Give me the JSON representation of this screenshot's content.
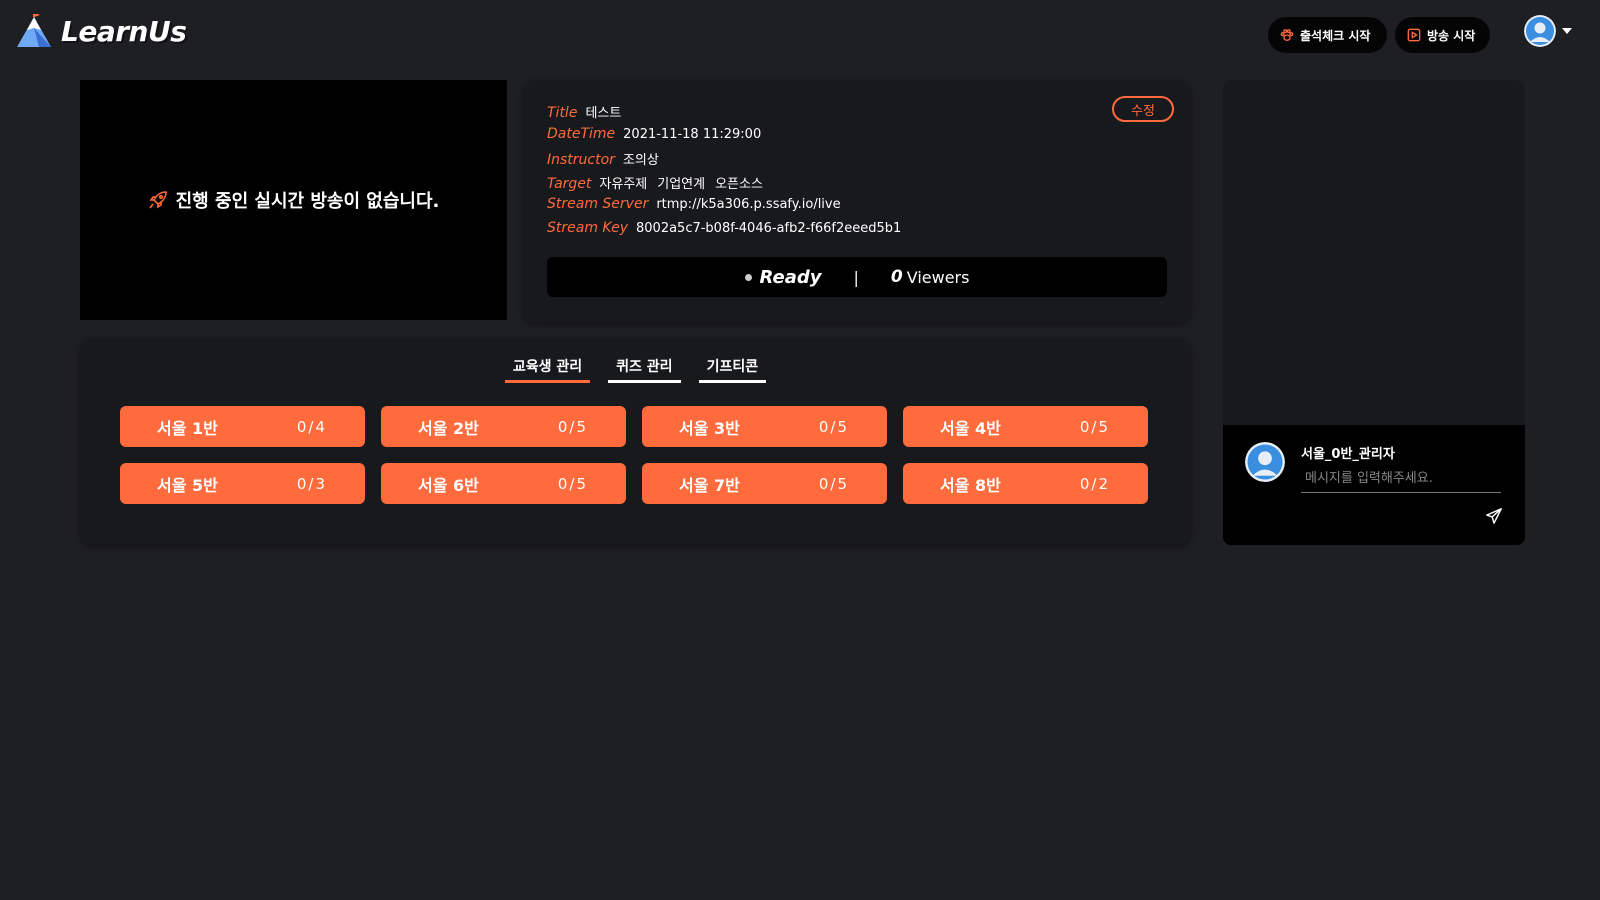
{
  "header": {
    "logo_text": "LearnUs",
    "attendance_button": "출석체크 시작",
    "broadcast_button": "방송 시작"
  },
  "video": {
    "no_stream_message": "진행 중인 실시간 방송이 없습니다."
  },
  "info": {
    "edit_button": "수정",
    "title_key": "Title",
    "title_value": "테스트",
    "datetime_key": "DateTime",
    "datetime_value": "2021-11-18 11:29:00",
    "instructor_key": "Instructor",
    "instructor_value": "조의상",
    "target_key": "Target",
    "targets": [
      "자유주제",
      "기업연계",
      "오픈소스"
    ],
    "server_key": "Stream Server",
    "server_value": "rtmp://k5a306.p.ssafy.io/live",
    "key_key": "Stream Key",
    "key_value": "8002a5c7-b08f-4046-afb2-f66f2eeed5b1"
  },
  "status": {
    "state": "Ready",
    "separator": "|",
    "viewer_count": "0",
    "viewers_label": "Viewers"
  },
  "tabs": [
    {
      "label": "교육생 관리",
      "active": true
    },
    {
      "label": "퀴즈 관리",
      "active": false
    },
    {
      "label": "기프티콘",
      "active": false
    }
  ],
  "classes": [
    {
      "name": "서울 1반",
      "count": "0/4"
    },
    {
      "name": "서울 2반",
      "count": "0/5"
    },
    {
      "name": "서울 3반",
      "count": "0/5"
    },
    {
      "name": "서울 4반",
      "count": "0/5"
    },
    {
      "name": "서울 5반",
      "count": "0/3"
    },
    {
      "name": "서울 6반",
      "count": "0/5"
    },
    {
      "name": "서울 7반",
      "count": "0/5"
    },
    {
      "name": "서울 8반",
      "count": "0/2"
    }
  ],
  "chat": {
    "username": "서울_0반_관리자",
    "placeholder": "메시지를 입력해주세요."
  },
  "colors": {
    "accent": "#ff6b3d",
    "background": "#1e1f23",
    "panel": "#18191c"
  },
  "icons": {
    "logo": "mountain-logo-icon",
    "attendance": "paw-icon",
    "broadcast": "play-square-icon",
    "video": "rocket-icon",
    "send": "send-icon",
    "avatar": "user-avatar-icon"
  }
}
